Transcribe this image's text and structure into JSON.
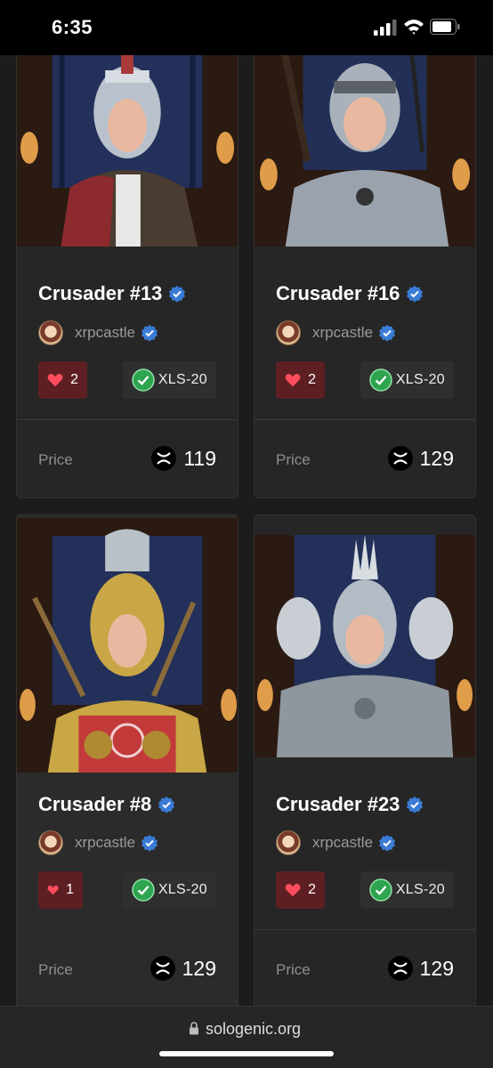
{
  "status": {
    "time": "6:35"
  },
  "cards": [
    {
      "title": "Crusader #13",
      "creator": "xrpcastle",
      "likes": "2",
      "standard": "XLS-20",
      "price_label": "Price",
      "price": "119"
    },
    {
      "title": "Crusader #16",
      "creator": "xrpcastle",
      "likes": "2",
      "standard": "XLS-20",
      "price_label": "Price",
      "price": "129"
    },
    {
      "title": "Crusader #8",
      "creator": "xrpcastle",
      "likes": "1",
      "standard": "XLS-20",
      "price_label": "Price",
      "price": "129"
    },
    {
      "title": "Crusader #23",
      "creator": "xrpcastle",
      "likes": "2",
      "standard": "XLS-20",
      "price_label": "Price",
      "price": "129"
    }
  ],
  "browser": {
    "url": "sologenic.org"
  },
  "colors": {
    "background": "#1c1c1c",
    "card": "#262626",
    "likes_bg": "#5e1f22",
    "verified": "#3a7bd5",
    "check": "#2ea44f"
  },
  "icons": [
    "verified-icon",
    "heart-icon",
    "check-icon",
    "xrp-icon",
    "lock-icon",
    "signal-icon",
    "wifi-icon",
    "battery-icon"
  ]
}
